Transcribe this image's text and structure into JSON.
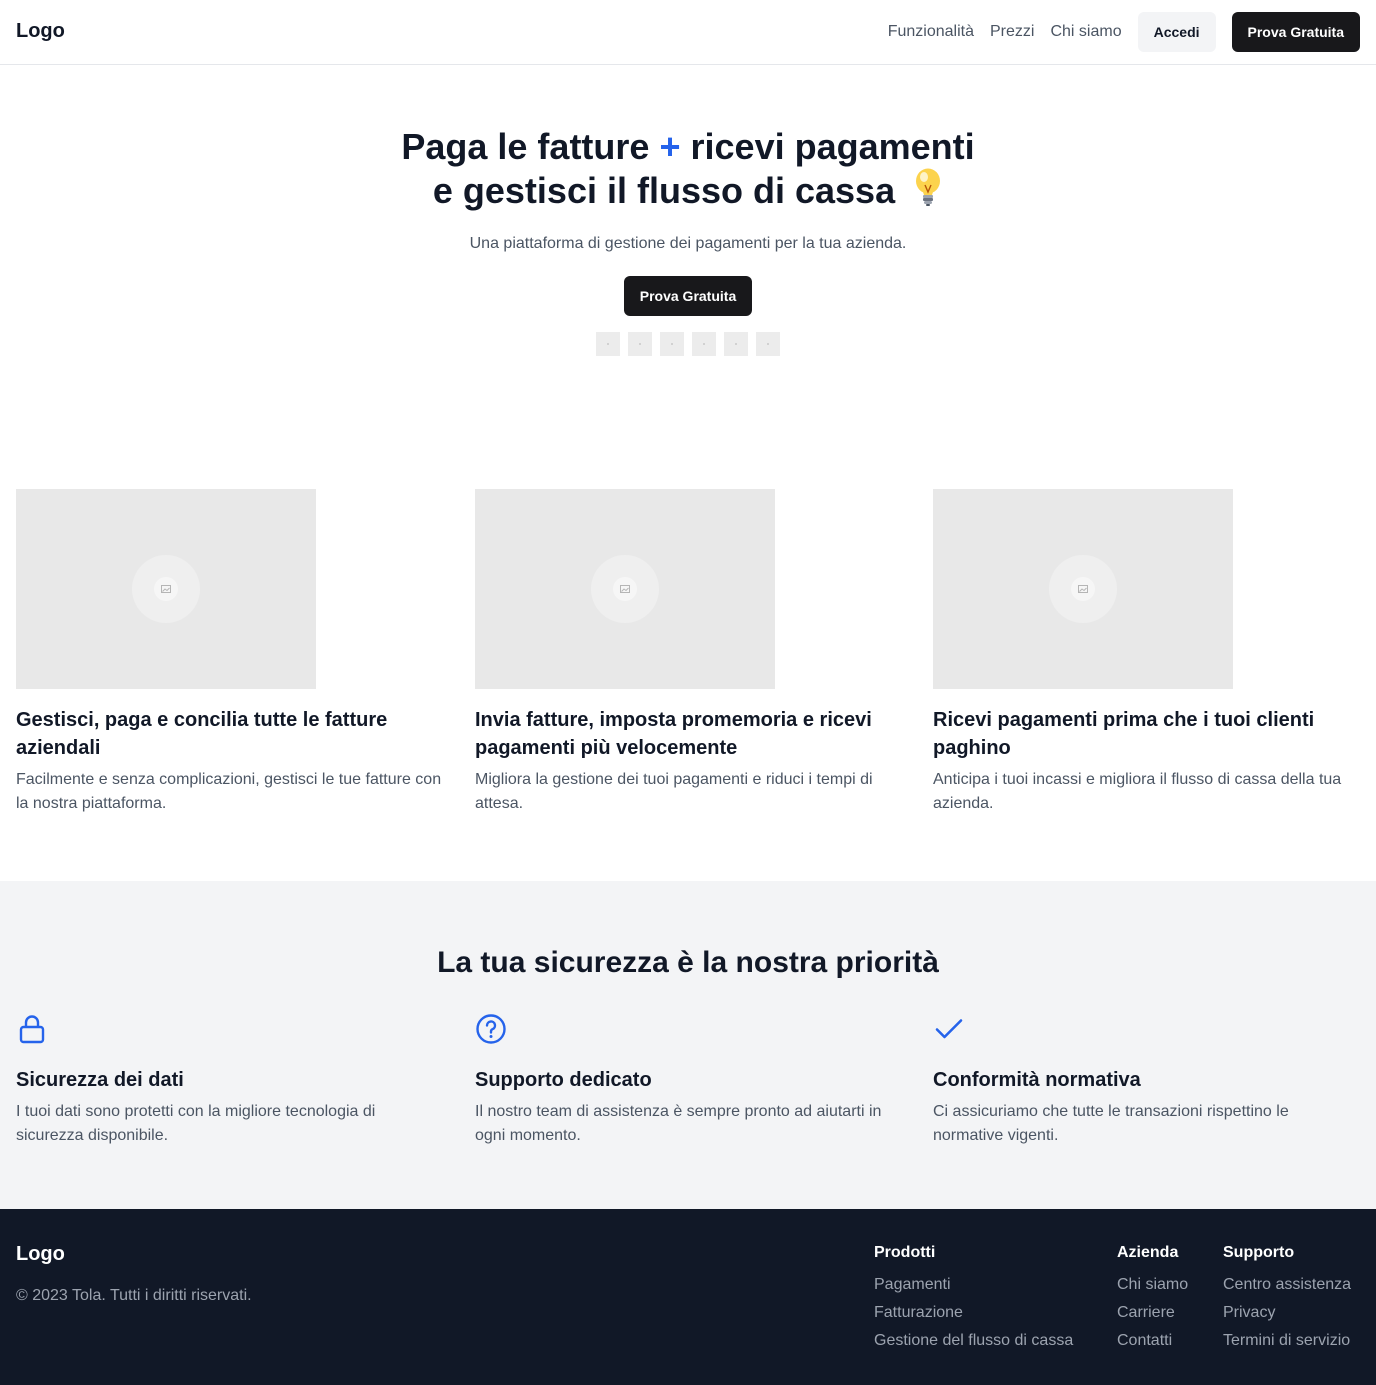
{
  "header": {
    "logo": "Logo",
    "nav": [
      "Funzionalità",
      "Prezzi",
      "Chi siamo"
    ],
    "login_label": "Accedi",
    "cta_label": "Prova Gratuita"
  },
  "hero": {
    "title_part1": "Paga le fatture",
    "title_plus": "+",
    "title_part2": "ricevi pagamenti",
    "title_line2": "e gestisci il flusso di cassa",
    "subtitle": "Una piattaforma di gestione dei pagamenti per la tua azienda.",
    "cta_label": "Prova Gratuita",
    "partner_count": 6
  },
  "features": [
    {
      "title": "Gestisci, paga e concilia tutte le fatture aziendali",
      "desc": "Facilmente e senza complicazioni, gestisci le tue fatture con la nostra piattaforma."
    },
    {
      "title": "Invia fatture, imposta promemoria e ricevi pagamenti più velocemente",
      "desc": "Migliora la gestione dei tuoi pagamenti e riduci i tempi di attesa."
    },
    {
      "title": "Ricevi pagamenti prima che i tuoi clienti paghino",
      "desc": "Anticipa i tuoi incassi e migliora il flusso di cassa della tua azienda."
    }
  ],
  "security": {
    "title": "La tua sicurezza è la nostra priorità",
    "accent_color": "#2563eb",
    "items": [
      {
        "icon": "lock-icon",
        "title": "Sicurezza dei dati",
        "desc": "I tuoi dati sono protetti con la migliore tecnologia di sicurezza disponibile."
      },
      {
        "icon": "help-circle-icon",
        "title": "Supporto dedicato",
        "desc": "Il nostro team di assistenza è sempre pronto ad aiutarti in ogni momento."
      },
      {
        "icon": "check-icon",
        "title": "Conformità normativa",
        "desc": "Ci assicuriamo che tutte le transazioni rispettino le normative vigenti."
      }
    ]
  },
  "footer": {
    "logo": "Logo",
    "copyright": "© 2023 Tola. Tutti i diritti riservati.",
    "columns": [
      {
        "title": "Prodotti",
        "links": [
          "Pagamenti",
          "Fatturazione",
          "Gestione del flusso di cassa"
        ]
      },
      {
        "title": "Azienda",
        "links": [
          "Chi siamo",
          "Carriere",
          "Contatti"
        ]
      },
      {
        "title": "Supporto",
        "links": [
          "Centro assistenza",
          "Privacy",
          "Termini di servizio"
        ]
      }
    ]
  }
}
